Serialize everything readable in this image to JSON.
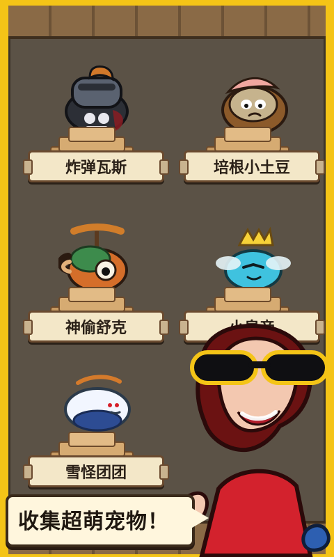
{
  "pets": [
    {
      "name": "炸弹瓦斯"
    },
    {
      "name": "培根小土豆"
    },
    {
      "name": "神偷舒克"
    },
    {
      "name": "小皇帝"
    },
    {
      "name": "雪怪团团"
    }
  ],
  "banner": {
    "text": "收集超萌宠物！"
  },
  "colors": {
    "frame": "#f4c417",
    "wall": "#5b5246",
    "label_bg": "#f3e7c8"
  }
}
